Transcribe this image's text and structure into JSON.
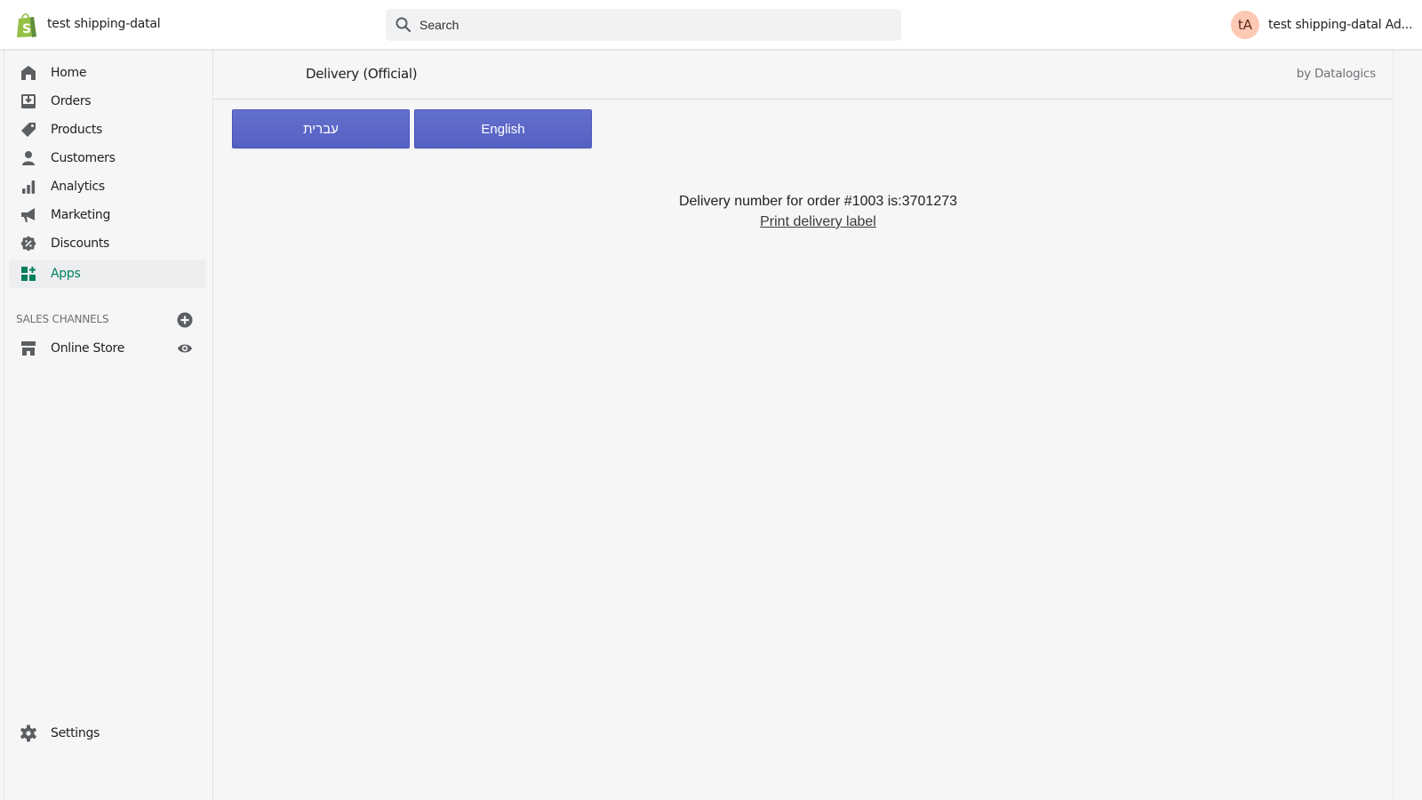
{
  "topbar": {
    "store_name": "test shipping-datal",
    "search_placeholder": "Search",
    "user_initials": "tA",
    "user_name": "test shipping-datal Ad..."
  },
  "sidebar": {
    "items": [
      {
        "label": "Home",
        "icon": "home-icon"
      },
      {
        "label": "Orders",
        "icon": "orders-icon"
      },
      {
        "label": "Products",
        "icon": "tag-icon"
      },
      {
        "label": "Customers",
        "icon": "person-icon"
      },
      {
        "label": "Analytics",
        "icon": "bar-chart-icon"
      },
      {
        "label": "Marketing",
        "icon": "megaphone-icon"
      },
      {
        "label": "Discounts",
        "icon": "discount-icon"
      },
      {
        "label": "Apps",
        "icon": "apps-icon",
        "active": true
      }
    ],
    "sales_channels_title": "SALES CHANNELS",
    "channels": [
      {
        "label": "Online Store",
        "icon": "store-icon"
      }
    ],
    "settings_label": "Settings"
  },
  "app": {
    "title": "Delivery (Official)",
    "by": "by Datalogics",
    "buttons": {
      "hebrew": "עברית",
      "english": "English"
    },
    "message": "Delivery number for order #1003 is:3701273",
    "print_link": "Print delivery label"
  },
  "colors": {
    "accent_green": "#007f5f",
    "button_blue": "#5c67c8",
    "avatar_bg": "#fdc9b5"
  }
}
